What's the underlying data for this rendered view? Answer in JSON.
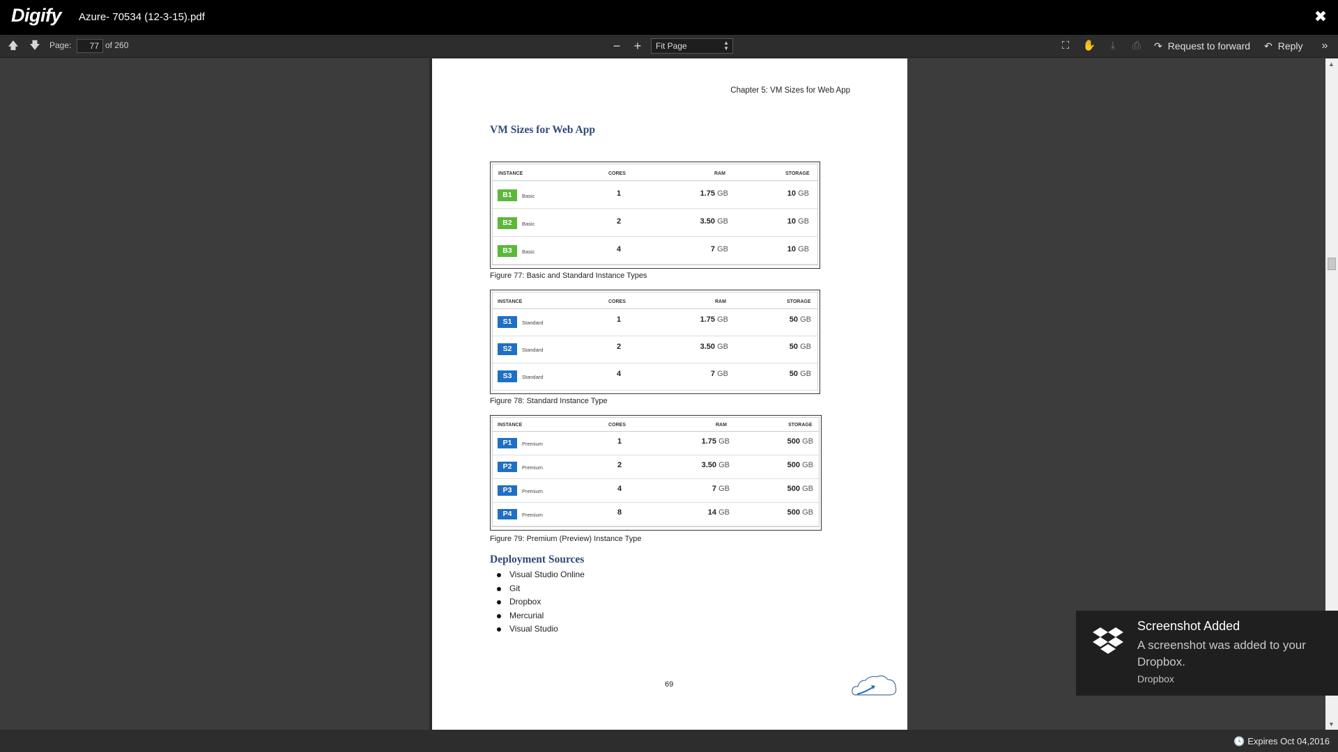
{
  "app": {
    "brand": "Digify",
    "document_title": "Azure- 70534 (12-3-15).pdf"
  },
  "toolbar": {
    "page_label": "Page:",
    "current_page": "77",
    "page_total": "of 260",
    "zoom_out": "−",
    "zoom_in": "+",
    "zoom_value": "Fit Page",
    "request_forward": "Request to forward",
    "reply": "Reply"
  },
  "pdf_page": {
    "chapter_header": "Chapter 5: VM Sizes for Web App",
    "section_title": "VM Sizes for Web App",
    "tables": [
      {
        "headers": [
          "INSTANCE",
          "CORES",
          "RAM",
          "STORAGE"
        ],
        "badge_color": "#5cb83a",
        "rows": [
          {
            "id": "B1",
            "tier": "Basic",
            "cores": "1",
            "ram": "1.75",
            "storage": "10",
            "unit": "GB"
          },
          {
            "id": "B2",
            "tier": "Basic",
            "cores": "2",
            "ram": "3.50",
            "storage": "10",
            "unit": "GB"
          },
          {
            "id": "B3",
            "tier": "Basic",
            "cores": "4",
            "ram": "7",
            "storage": "10",
            "unit": "GB"
          }
        ],
        "caption": "Figure 77: Basic and Standard Instance Types"
      },
      {
        "headers": [
          "INSTANCE",
          "CORES",
          "RAM",
          "STORAGE"
        ],
        "badge_color": "#1f6fc5",
        "rows": [
          {
            "id": "S1",
            "tier": "Standard",
            "cores": "1",
            "ram": "1.75",
            "storage": "50",
            "unit": "GB"
          },
          {
            "id": "S2",
            "tier": "Standard",
            "cores": "2",
            "ram": "3.50",
            "storage": "50",
            "unit": "GB"
          },
          {
            "id": "S3",
            "tier": "Standard",
            "cores": "4",
            "ram": "7",
            "storage": "50",
            "unit": "GB"
          }
        ],
        "caption": "Figure 78: Standard Instance Type"
      },
      {
        "headers": [
          "INSTANCE",
          "CORES",
          "RAM",
          "STORAGE"
        ],
        "badge_color": "#1f6fc5",
        "rows": [
          {
            "id": "P1",
            "tier": "Premium",
            "cores": "1",
            "ram": "1.75",
            "storage": "500",
            "unit": "GB"
          },
          {
            "id": "P2",
            "tier": "Premium",
            "cores": "2",
            "ram": "3.50",
            "storage": "500",
            "unit": "GB"
          },
          {
            "id": "P3",
            "tier": "Premium",
            "cores": "4",
            "ram": "7",
            "storage": "500",
            "unit": "GB"
          },
          {
            "id": "P4",
            "tier": "Premium",
            "cores": "8",
            "ram": "14",
            "storage": "500",
            "unit": "GB"
          }
        ],
        "caption": "Figure 79: Premium (Preview) Instance Type"
      }
    ],
    "deployment_title": "Deployment Sources",
    "deployment_sources": [
      "Visual Studio Online",
      "Git",
      "Dropbox",
      "Mercurial",
      "Visual Studio"
    ],
    "page_number": "69"
  },
  "status": {
    "expires": "Expires Oct 04,2016"
  },
  "toast": {
    "title": "Screenshot Added",
    "message": "A screenshot was added to your Dropbox.",
    "source": "Dropbox"
  },
  "colors": {
    "heading": "#2e4a75",
    "basic_badge": "#5cb83a",
    "standard_badge": "#1f6fc5",
    "titlebar": "#000000",
    "toolbar": "#2d2d2d"
  }
}
